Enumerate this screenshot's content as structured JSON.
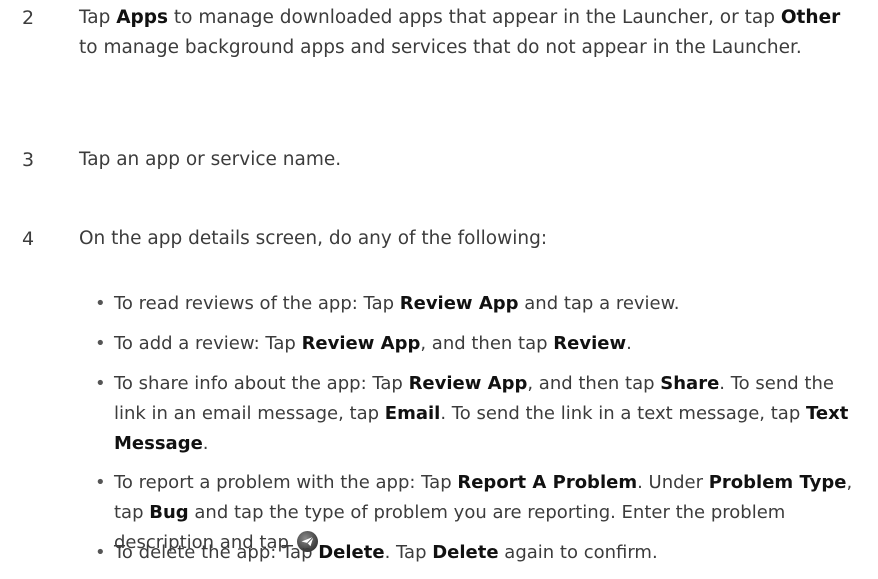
{
  "steps": [
    {
      "number": "2",
      "parts": [
        {
          "t": "Tap "
        },
        {
          "b": "Apps"
        },
        {
          "t": " to manage downloaded apps that appear in the Launcher, or tap "
        },
        {
          "b": "Other"
        },
        {
          "t": " to manage background apps and services that do not appear in the Launcher."
        }
      ]
    },
    {
      "number": "3",
      "parts": [
        {
          "t": "Tap an app or service name."
        }
      ]
    },
    {
      "number": "4",
      "parts": [
        {
          "t": "On the app details screen, do any of the following:"
        }
      ]
    }
  ],
  "bullets": [
    {
      "parts": [
        {
          "t": "To read reviews of the app: Tap "
        },
        {
          "b": "Review App"
        },
        {
          "t": " and tap a review."
        }
      ]
    },
    {
      "parts": [
        {
          "t": "To add a review: Tap "
        },
        {
          "b": "Review App"
        },
        {
          "t": ", and then tap "
        },
        {
          "b": "Review"
        },
        {
          "t": "."
        }
      ]
    },
    {
      "parts": [
        {
          "t": "To share info about the app: Tap "
        },
        {
          "b": "Review App"
        },
        {
          "t": ", and then tap "
        },
        {
          "b": "Share"
        },
        {
          "t": ". To send the link in an email message, tap "
        },
        {
          "b": "Email"
        },
        {
          "t": ". To send the link in a text message, tap "
        },
        {
          "b": "Text Message"
        },
        {
          "t": "."
        }
      ]
    },
    {
      "parts": [
        {
          "t": "To report a problem with the app: Tap "
        },
        {
          "b": "Report A Problem"
        },
        {
          "t": ". Under "
        },
        {
          "b": "Problem Type"
        },
        {
          "t": ", tap "
        },
        {
          "b": "Bug"
        },
        {
          "t": " and tap the type of problem you are reporting. Enter the problem description and tap "
        },
        {
          "icon": "send-icon"
        },
        {
          "t": "."
        }
      ]
    },
    {
      "parts": [
        {
          "t": "To delete the app: Tap "
        },
        {
          "b": "Delete"
        },
        {
          "t": ". Tap "
        },
        {
          "b": "Delete"
        },
        {
          "t": " again to confirm."
        }
      ]
    }
  ],
  "bullet_symbol": "•"
}
